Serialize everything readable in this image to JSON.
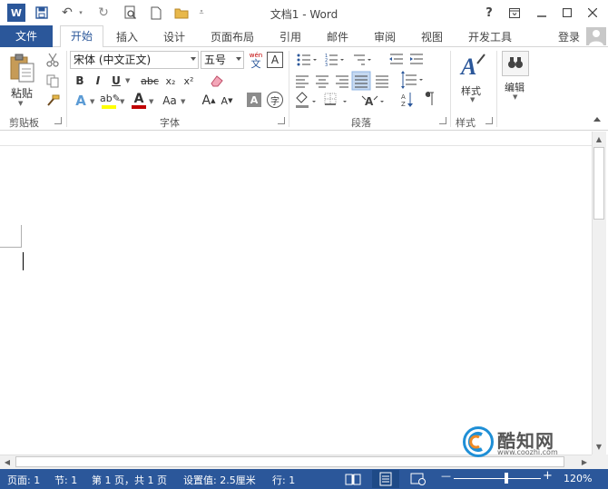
{
  "window": {
    "title": "文档1 - Word"
  },
  "window_controls": {
    "help": "?",
    "ribbon_options": "⊡",
    "minimize": "—",
    "maximize": "☐",
    "close": "✕"
  },
  "qat": {
    "word_logo": "W",
    "save": "💾",
    "undo": "↶",
    "redo": "↻",
    "print_preview": "🔍",
    "new": "🗋",
    "open": "📂",
    "customize": "⩡"
  },
  "tabs": {
    "file": "文件",
    "items": [
      "开始",
      "插入",
      "设计",
      "页面布局",
      "引用",
      "邮件",
      "审阅",
      "视图",
      "开发工具"
    ],
    "login": "登录"
  },
  "ribbon": {
    "clipboard": {
      "paste_label": "粘贴",
      "group_label": "剪贴板"
    },
    "font": {
      "font_name": "宋体 (中文正文)",
      "font_size": "五号",
      "phonetic_top": "wén",
      "phonetic_bottom": "文",
      "border_char": "A",
      "bold": "B",
      "italic": "I",
      "underline": "U",
      "strike": "abc",
      "subscript": "x₂",
      "superscript": "x²",
      "grow": "A",
      "shrink": "A",
      "case": "Aa",
      "char_shading": "A",
      "enclose": "字",
      "group_label": "字体"
    },
    "paragraph": {
      "group_label": "段落"
    },
    "styles": {
      "label": "样式",
      "group_label": "样式"
    },
    "editing": {
      "label": "编辑"
    }
  },
  "statusbar": {
    "page": "页面: 1",
    "section": "节: 1",
    "page_of": "第 1 页，共 1 页",
    "setting": "设置值: 2.5厘米",
    "line": "行: 1",
    "zoom": "120%",
    "zoom_minus": "—",
    "zoom_plus": "+",
    "zoom_fraction": 0.6
  },
  "watermark": {
    "name": "酷知网",
    "url": "www.coozhi.com"
  },
  "colors": {
    "accent": "#2b579a",
    "highlight": "#ffff00",
    "font_red": "#c00000"
  }
}
